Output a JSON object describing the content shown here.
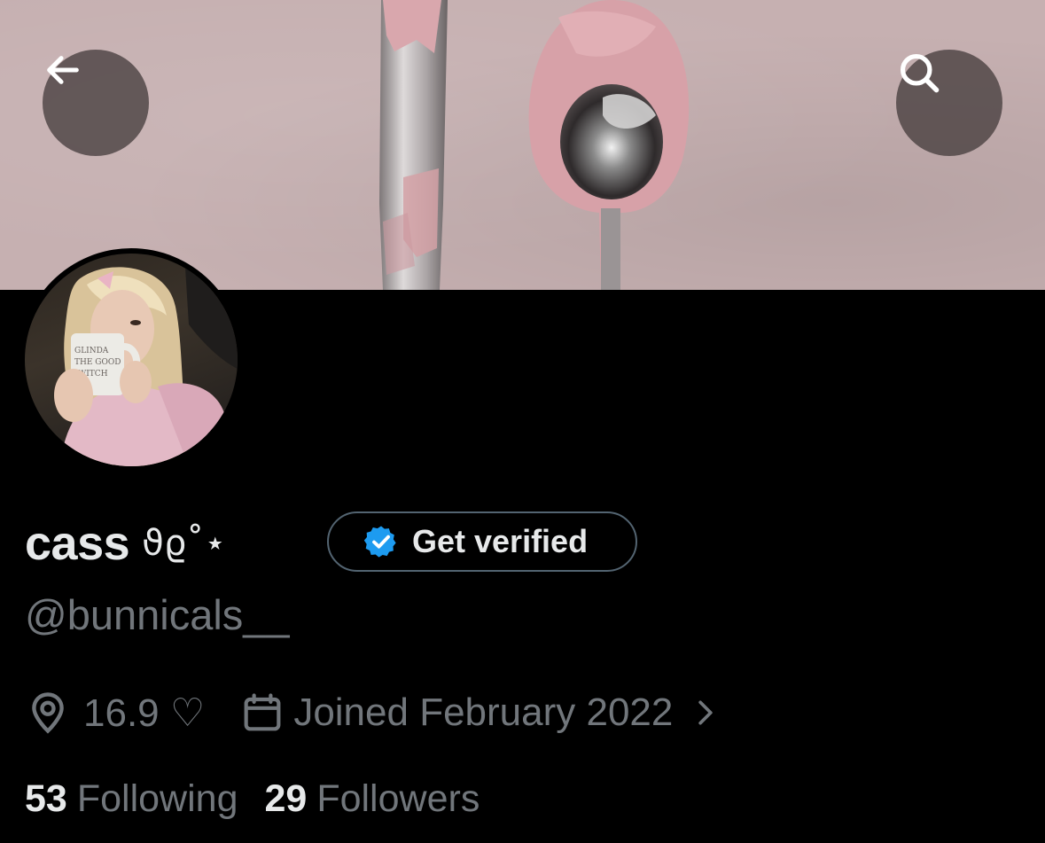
{
  "profile": {
    "display_name": "cass",
    "display_name_decoration": "ϑϱ˚⋆",
    "handle": "@bunnicals__",
    "location": "16.9 ♡",
    "joined": "Joined February 2022"
  },
  "verify_button": {
    "label": "Get verified"
  },
  "stats": {
    "following_count": "53",
    "following_label": "Following",
    "followers_count": "29",
    "followers_label": "Followers"
  },
  "avatar_image": {
    "mug_text": "GLINDA THE GOOD WITCH"
  },
  "icons": {
    "back": "arrow-left-icon",
    "search": "search-icon",
    "location": "location-pin-icon",
    "calendar": "calendar-icon",
    "chevron": "chevron-right-icon",
    "verified": "verified-badge-icon"
  },
  "colors": {
    "background": "#000000",
    "primary_text": "#e7e9ea",
    "secondary_text": "#71767b",
    "verified_blue": "#1d9bf0",
    "border": "#536471"
  }
}
